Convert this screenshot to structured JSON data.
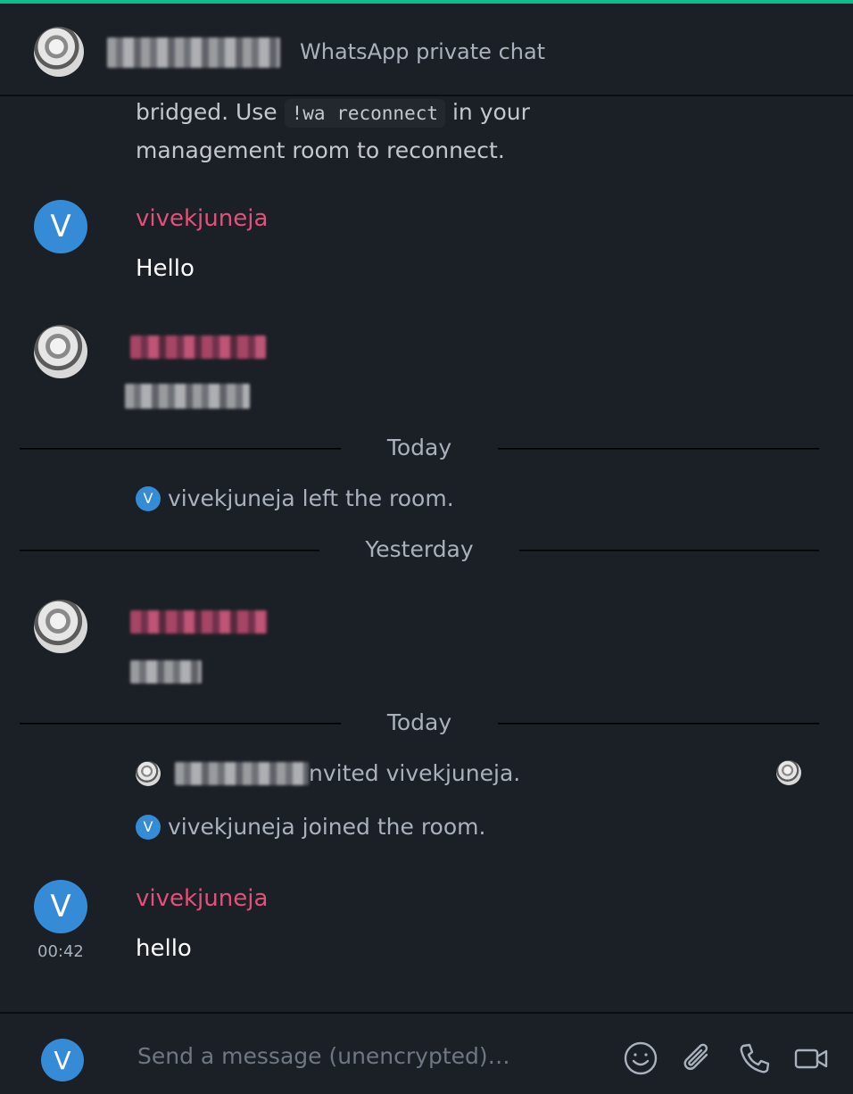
{
  "header": {
    "topic": "WhatsApp private chat"
  },
  "timeline": {
    "bridge_notice": {
      "text_before": "bridged. Use ",
      "code": "!wa reconnect",
      "text_after": " in your",
      "line2": "management room to reconnect."
    },
    "msg1": {
      "sender": "vivekjuneja",
      "avatar_letter": "V",
      "body": "Hello"
    },
    "separator1": "Today",
    "state1": {
      "avatar_letter": "V",
      "text": "vivekjuneja left the room."
    },
    "separator2": "Yesterday",
    "separator3": "Today",
    "state2": {
      "text": "nvited vivekjuneja."
    },
    "state3": {
      "avatar_letter": "V",
      "text": "vivekjuneja joined the room."
    },
    "msg2": {
      "sender": "vivekjuneja",
      "avatar_letter": "V",
      "body": "hello",
      "timestamp": "00:42"
    }
  },
  "composer": {
    "avatar_letter": "V",
    "placeholder": "Send a message (unencrypted)…"
  },
  "colors": {
    "accent": "#0dbd8b",
    "background": "#1b1f26",
    "sender": "#e64f7a",
    "avatar": "#368bd6"
  },
  "icons": [
    "emoji-icon",
    "paperclip-icon",
    "phone-icon",
    "video-icon"
  ]
}
